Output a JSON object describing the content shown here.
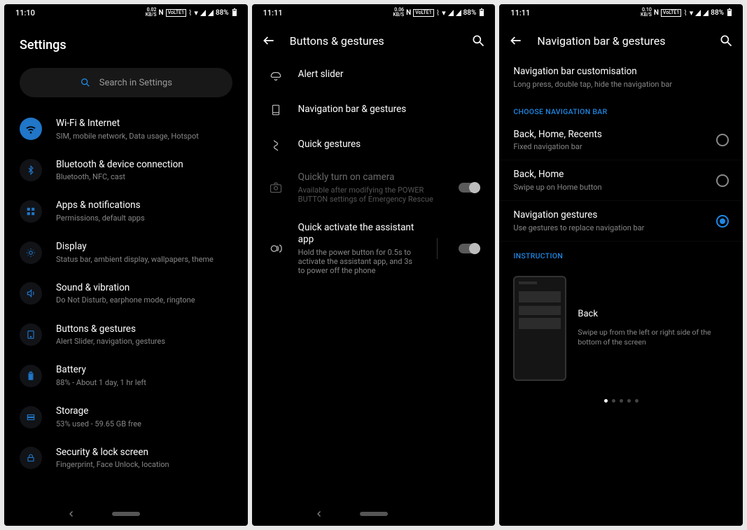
{
  "screens": [
    {
      "status": {
        "time": "11:10",
        "speed_top": "0.02",
        "speed_unit": "KB/S",
        "volte": "VoLTE1",
        "battery_pct": "88%"
      },
      "title": "Settings",
      "search_placeholder": "Search in Settings",
      "items": [
        {
          "label": "Wi-Fi & Internet",
          "sub": "SIM, mobile network, Data usage, Hotspot",
          "icon": "wifi",
          "solid": true
        },
        {
          "label": "Bluetooth & device connection",
          "sub": "Bluetooth, NFC, cast",
          "icon": "bluetooth"
        },
        {
          "label": "Apps & notifications",
          "sub": "Permissions, default apps",
          "icon": "grid"
        },
        {
          "label": "Display",
          "sub": "Status bar, ambient display, wallpapers, theme",
          "icon": "bulb"
        },
        {
          "label": "Sound & vibration",
          "sub": "Do Not Disturb, earphone mode, ringtone",
          "icon": "sound"
        },
        {
          "label": "Buttons & gestures",
          "sub": "Alert Slider, navigation, gestures",
          "icon": "gesture"
        },
        {
          "label": "Battery",
          "sub": "88% - About 1 day, 1 hr left",
          "icon": "battery"
        },
        {
          "label": "Storage",
          "sub": "53% used - 59.65 GB free",
          "icon": "storage"
        },
        {
          "label": "Security & lock screen",
          "sub": "Fingerprint, Face Unlock, location",
          "icon": "lock"
        }
      ]
    },
    {
      "status": {
        "time": "11:11",
        "speed_top": "0.06",
        "speed_unit": "KB/S",
        "volte": "VoLTE1",
        "battery_pct": "88%"
      },
      "title": "Buttons & gestures",
      "items": [
        {
          "label": "Alert slider",
          "icon": "bell"
        },
        {
          "label": "Navigation bar & gestures",
          "icon": "navbar"
        },
        {
          "label": "Quick gestures",
          "icon": "quickgest"
        },
        {
          "label": "Quickly turn on camera",
          "sub": "Available after modifying the POWER BUTTON settings of Emergency Rescue",
          "icon": "camera",
          "disabled": true,
          "toggle": "on"
        },
        {
          "label": "Quick activate the assistant app",
          "sub": "Hold the power button for 0.5s to activate the assistant app, and 3s to power off the phone",
          "icon": "assistant",
          "toggle": "on",
          "hasSep": true
        }
      ]
    },
    {
      "status": {
        "time": "11:11",
        "speed_top": "0.10",
        "speed_unit": "KB/S",
        "volte": "VoLTE1",
        "battery_pct": "88%"
      },
      "title": "Navigation bar & gestures",
      "top_item": {
        "label": "Navigation bar customisation",
        "sub": "Long press, double tap, hide the navigation bar"
      },
      "section_choose": "CHOOSE NAVIGATION BAR",
      "options": [
        {
          "label": "Back, Home, Recents",
          "sub": "Fixed navigation bar",
          "checked": false
        },
        {
          "label": "Back, Home",
          "sub": "Swipe up on Home button",
          "checked": false
        },
        {
          "label": "Navigation gestures",
          "sub": "Use gestures to replace navigation bar",
          "checked": true
        }
      ],
      "section_instr": "INSTRUCTION",
      "instruction": {
        "title": "Back",
        "sub": "Swipe up from the left or right side of the bottom of the screen"
      }
    }
  ]
}
